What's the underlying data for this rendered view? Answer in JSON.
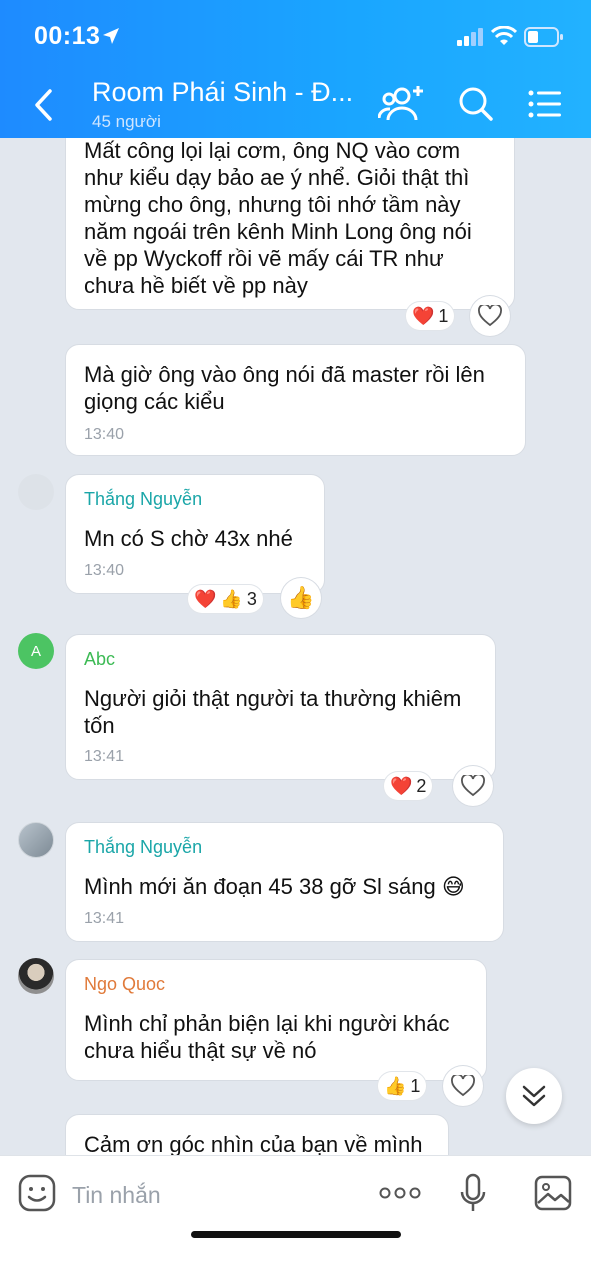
{
  "status_bar": {
    "time": "00:13"
  },
  "header": {
    "title": "Room Phái Sinh - Đ...",
    "subtitle": "45 người"
  },
  "messages": [
    {
      "lines": [
        "Mất công lọi lại cơm, ông NQ vào cơm",
        "như kiểu dạy bảo ae ý nhể. Giỏi thật thì",
        "mừng cho ông, nhưng tôi nhớ tầm này",
        "năm ngoái trên kênh Minh Long ông nói",
        "về pp Wyckoff rồi vẽ mấy cái TR như",
        "chưa hề biết về pp này"
      ],
      "reaction_count": "1"
    },
    {
      "lines": [
        "Mà giờ ông vào ông nói đã master rồi lên",
        "giọng các kiểu"
      ],
      "time": "13:40"
    },
    {
      "sender": "Thắng Nguyễn",
      "lines": [
        "Mn có S chờ 43x nhé"
      ],
      "time": "13:40",
      "reaction_count": "3"
    },
    {
      "sender": "Abc",
      "avatar_letter": "A",
      "lines": [
        "Người giỏi thật người ta thường khiêm",
        "tốn"
      ],
      "time": "13:41",
      "reaction_count": "2"
    },
    {
      "sender": "Thắng Nguyễn",
      "lines": [
        "Mình mới ăn đoạn 45 38 gỡ Sl sáng 😅"
      ],
      "time": "13:41"
    },
    {
      "sender": "Ngo Quoc",
      "lines": [
        "Mình chỉ phản biện lại khi người khác",
        "chưa hiểu thật sự về nó"
      ],
      "reaction_count": "1"
    },
    {
      "lines": [
        "Cảm ơn góc nhìn của bạn về mình"
      ]
    }
  ],
  "composer": {
    "placeholder": "Tin nhắn"
  },
  "colors": {
    "header": "#1e8bff",
    "sender_thang": "#1aa6a8",
    "sender_abc": "#3cba54",
    "sender_ngo": "#e07a3a",
    "chat_bg": "#e2e7ee"
  }
}
